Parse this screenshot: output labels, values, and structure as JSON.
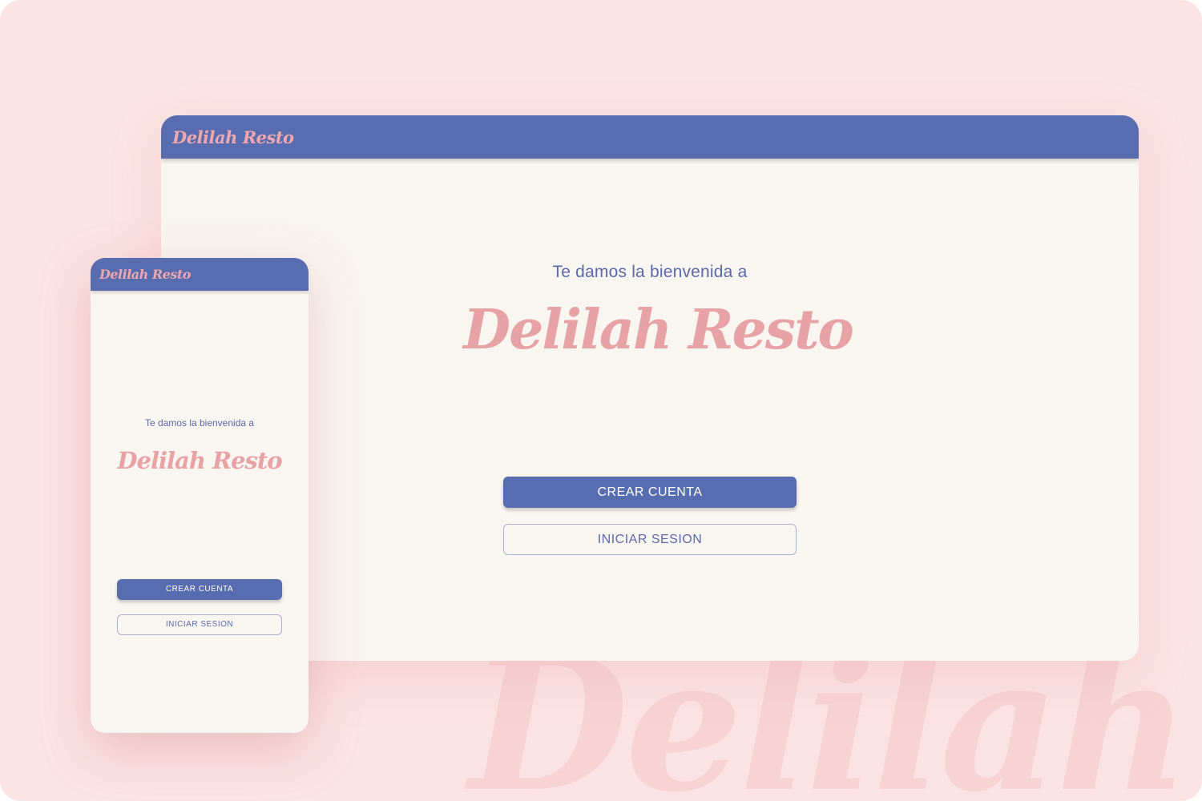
{
  "brand": {
    "name": "Delilah Resto",
    "watermark": "Delilah Re"
  },
  "desktop": {
    "header_brand": "Delilah Resto",
    "welcome_text": "Te damos la bienvenida a",
    "title": "Delilah Resto",
    "create_account_label": "CREAR CUENTA",
    "login_label": "INICIAR SESION"
  },
  "mobile": {
    "header_brand": "Delilah Resto",
    "welcome_text": "Te damos la bienvenida a",
    "title": "Delilah Resto",
    "create_account_label": "CREAR CUENTA",
    "login_label": "INICIAR SESION"
  },
  "colors": {
    "background": "#fce3e3",
    "header": "#586daf",
    "brand_pink": "#e7a2a6",
    "surface": "#f9f5f1",
    "text_blue": "#5a6aa8"
  }
}
